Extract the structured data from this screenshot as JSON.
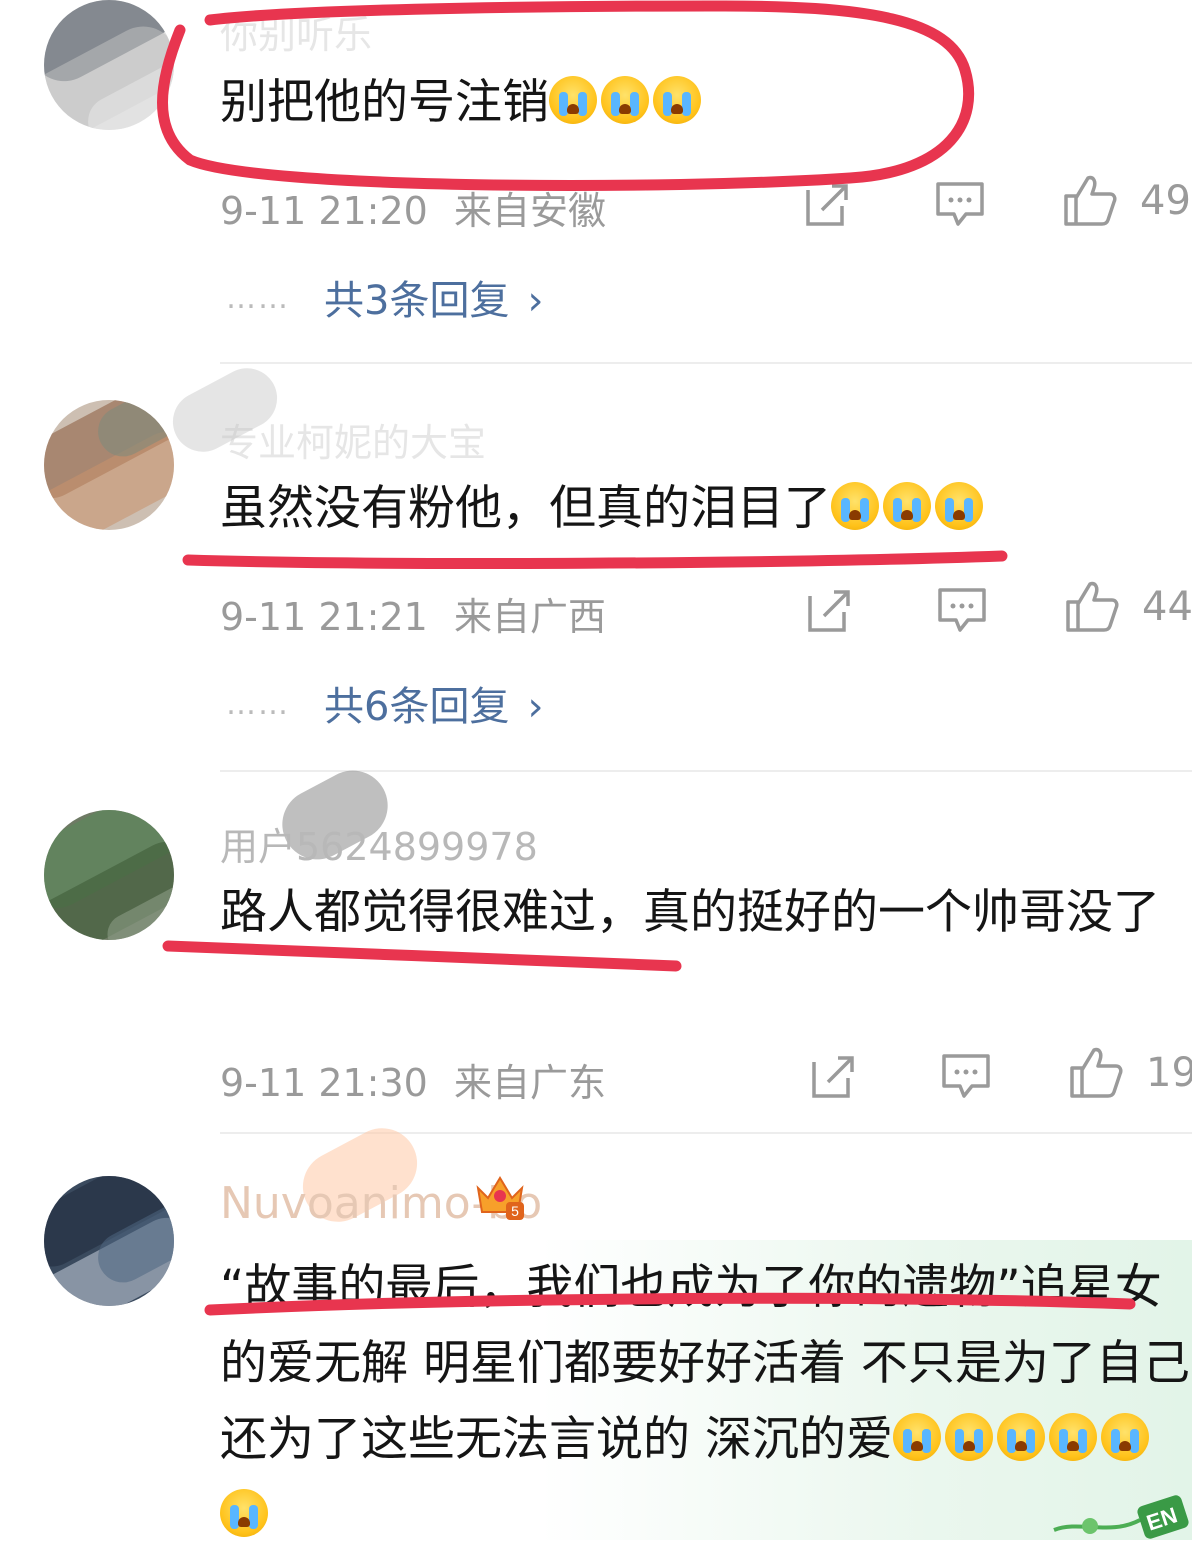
{
  "comments": [
    {
      "username": "你别听乐",
      "content": "别把他的号注销",
      "emoji_count": 3,
      "time": "9-11 21:20",
      "location": "来自安徽",
      "likes": "49",
      "replies_label": "共3条回复",
      "dots": "……"
    },
    {
      "username": "专业柯妮的大宝",
      "content": "虽然没有粉他，但真的泪目了",
      "emoji_count": 3,
      "time": "9-11 21:21",
      "location": "来自广西",
      "likes": "44",
      "replies_label": "共6条回复",
      "dots": "……"
    },
    {
      "username": "用户5624899978",
      "content": "路人都觉得很难过，真的挺好的一个帅哥没了",
      "emoji_count": 0,
      "time": "9-11 21:30",
      "location": "来自广东",
      "likes": "19"
    },
    {
      "username": "Nuvoanimo-bo",
      "content": "“故事的最后，我们也成为了你的遗物”追星女的爱无解  明星们都要好好活着 不只是为了自己 还为了这些无法言说的 深沉的爱",
      "emoji_count": 6,
      "badge_level": "5"
    }
  ],
  "icons": {
    "share": "share-icon",
    "comment": "comment-icon",
    "like": "like-icon",
    "emoji": "crying-face-emoji",
    "badge": "crown-badge-icon",
    "chevron": "chevron-right-icon"
  },
  "colors": {
    "link": "#4d6f9e",
    "meta": "#9a9a9a",
    "annotation_red": "#e8354f",
    "username": "#c8c8c8"
  },
  "watermark": "EN"
}
